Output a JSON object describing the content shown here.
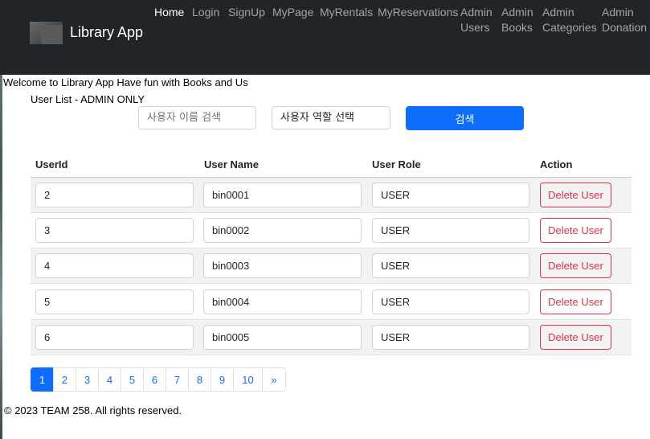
{
  "navbar": {
    "brand": "Library App",
    "logo_text": "",
    "items": [
      {
        "label": "Home",
        "active": true
      },
      {
        "label": "Login"
      },
      {
        "label": "SignUp"
      },
      {
        "label": "MyPage"
      },
      {
        "label": "MyRentals"
      },
      {
        "label": "MyReservations"
      },
      {
        "label": "Admin\nUsers"
      },
      {
        "label": "Admin\nBooks"
      },
      {
        "label": "Admin\nCategories"
      },
      {
        "label": "Admin\nDonation"
      }
    ]
  },
  "welcome": "Welcome to Library App Have fun with Books and Us",
  "subtitle": "User List - ADMIN ONLY",
  "search": {
    "name_placeholder": "사용자 이름 검색",
    "role_placeholder": "사용자 역할 선택",
    "button_label": "검색"
  },
  "table": {
    "headers": [
      "UserId",
      "User Name",
      "User Role",
      "Action"
    ],
    "rows": [
      {
        "id": "2",
        "name": "bin0001",
        "role": "USER",
        "action": "Delete User"
      },
      {
        "id": "3",
        "name": "bin0002",
        "role": "USER",
        "action": "Delete User"
      },
      {
        "id": "4",
        "name": "bin0003",
        "role": "USER",
        "action": "Delete User"
      },
      {
        "id": "5",
        "name": "bin0004",
        "role": "USER",
        "action": "Delete User"
      },
      {
        "id": "6",
        "name": "bin0005",
        "role": "USER",
        "action": "Delete User"
      }
    ]
  },
  "pagination": {
    "pages": [
      "1",
      "2",
      "3",
      "4",
      "5",
      "6",
      "7",
      "8",
      "9",
      "10"
    ],
    "current": "1",
    "next_label": "»"
  },
  "footer": "© 2023 TEAM 258. All rights reserved.",
  "colors": {
    "navbar_bg": "#212529",
    "primary": "#0d6efd",
    "danger": "#dc3545",
    "stripe": "#f2f2f2"
  }
}
